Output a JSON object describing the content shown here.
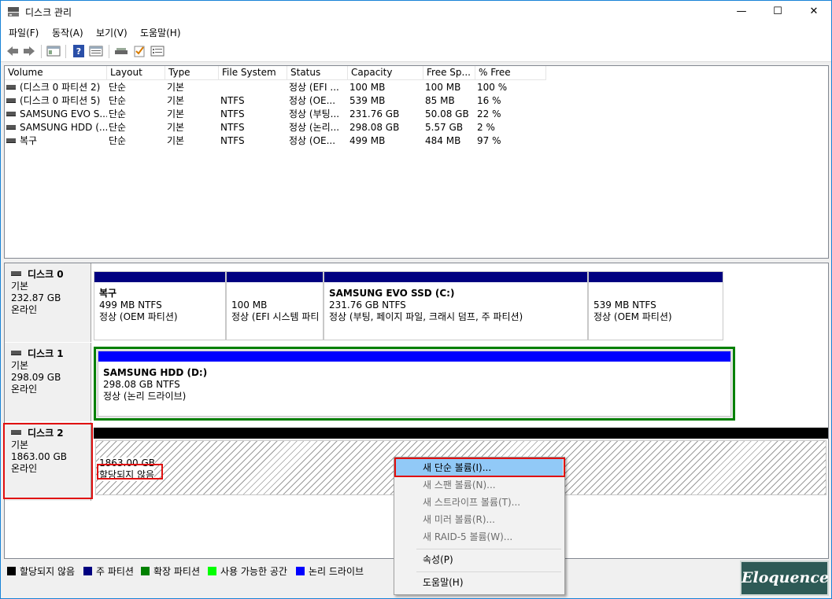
{
  "window": {
    "title": "디스크 관리",
    "controls": {
      "minimize": "—",
      "maximize": "☐",
      "close": "✕"
    }
  },
  "menu": [
    "파일(F)",
    "동작(A)",
    "보기(V)",
    "도움말(H)"
  ],
  "toolbar_icons": [
    "back-icon",
    "forward-icon",
    "console-tree-icon",
    "help-icon",
    "properties-icon",
    "rescan-disks-icon",
    "check-icon",
    "list-view-icon"
  ],
  "volume_list": {
    "headers": [
      "Volume",
      "Layout",
      "Type",
      "File System",
      "Status",
      "Capacity",
      "Free Sp...",
      "% Free"
    ],
    "rows": [
      [
        "(디스크 0 파티션 2)",
        "단순",
        "기본",
        "",
        "정상 (EFI ...",
        "100 MB",
        "100 MB",
        "100 %"
      ],
      [
        "(디스크 0 파티션 5)",
        "단순",
        "기본",
        "NTFS",
        "정상 (OE...",
        "539 MB",
        "85 MB",
        "16 %"
      ],
      [
        "SAMSUNG EVO S...",
        "단순",
        "기본",
        "NTFS",
        "정상 (부팅...",
        "231.76 GB",
        "50.08 GB",
        "22 %"
      ],
      [
        "SAMSUNG HDD (...",
        "단순",
        "기본",
        "NTFS",
        "정상 (논리...",
        "298.08 GB",
        "5.57 GB",
        "2 %"
      ],
      [
        "복구",
        "단순",
        "기본",
        "NTFS",
        "정상 (OE...",
        "499 MB",
        "484 MB",
        "97 %"
      ]
    ]
  },
  "disks": [
    {
      "name": "디스크 0",
      "type": "기본",
      "size": "232.87 GB",
      "status": "온라인",
      "partitions": [
        {
          "name": "복구",
          "size": "499 MB NTFS",
          "status": "정상 (OEM 파티션)"
        },
        {
          "name": "",
          "size": "100 MB",
          "status": "정상 (EFI 시스템 파티"
        },
        {
          "name": "SAMSUNG EVO SSD  (C:)",
          "size": "231.76 GB NTFS",
          "status": "정상 (부팅, 페이지 파일, 크래시 덤프, 주 파티션)"
        },
        {
          "name": "",
          "size": "539 MB NTFS",
          "status": "정상 (OEM 파티션)"
        }
      ]
    },
    {
      "name": "디스크 1",
      "type": "기본",
      "size": "298.09 GB",
      "status": "온라인",
      "partitions": [
        {
          "name": "SAMSUNG HDD  (D:)",
          "size": "298.08 GB NTFS",
          "status": "정상 (논리 드라이브)"
        }
      ]
    },
    {
      "name": "디스크 2",
      "type": "기본",
      "size": "1863.00 GB",
      "status": "온라인",
      "partitions": [
        {
          "name": "",
          "size": "1863.00 GB",
          "status": "할당되지 않음"
        }
      ]
    }
  ],
  "legend": [
    {
      "label": "할당되지 않음",
      "color": "#000000"
    },
    {
      "label": "주 파티션",
      "color": "#000080"
    },
    {
      "label": "확장 파티션",
      "color": "#008000"
    },
    {
      "label": "사용 가능한 공간",
      "color": "#00ff00"
    },
    {
      "label": "논리 드라이브",
      "color": "#0000ff"
    }
  ],
  "context_menu": {
    "items": [
      {
        "label": "새 단순 볼륨(I)...",
        "enabled": true,
        "highlighted": true
      },
      {
        "label": "새 스팬 볼륨(N)...",
        "enabled": false
      },
      {
        "label": "새 스트라이프 볼륨(T)...",
        "enabled": false
      },
      {
        "label": "새 미러 볼륨(R)...",
        "enabled": false
      },
      {
        "label": "새 RAID-5 볼륨(W)...",
        "enabled": false
      },
      {
        "label": "속성(P)",
        "enabled": true
      },
      {
        "label": "도움말(H)",
        "enabled": true
      }
    ]
  },
  "watermark": "Eloquence",
  "colors": {
    "primary_partition_bar": "#000080",
    "logical_drive_bar": "#0000ff",
    "extended_partition_border": "#008000",
    "unallocated_bar": "#000000",
    "menu_highlight": "#91c9f7",
    "annotation_red": "#e01010"
  }
}
